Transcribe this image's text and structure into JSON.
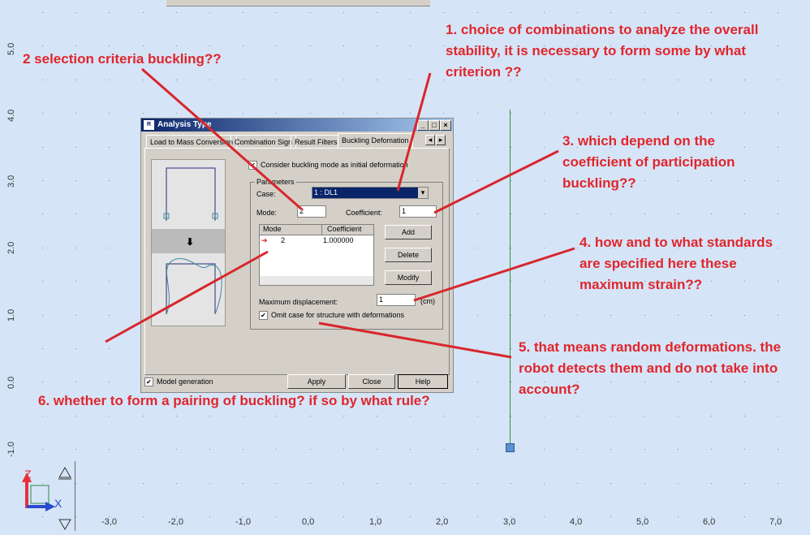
{
  "viewport": {
    "y_ticks": [
      "5.0",
      "4.0",
      "3.0",
      "2.0",
      "1.0",
      "0.0",
      "-1.0"
    ],
    "x_ticks": [
      "-3,0",
      "-2,0",
      "-1,0",
      "0,0",
      "1,0",
      "2,0",
      "3,0",
      "4,0",
      "5,0",
      "6,0",
      "7,0"
    ],
    "axis_z": "Z",
    "axis_x": "X",
    "colors": {
      "background": "#d6e4f7",
      "member": "#2a9a3a",
      "node": "#4a7fc0"
    }
  },
  "dialog": {
    "title": "Analysis Type",
    "tabs": [
      "Load to Mass Conversion",
      "Combination Sign",
      "Result Filters",
      "Buckling Defomation"
    ],
    "consider_label": "Consider buckling mode as initial deformation",
    "parameters_label": "Parameters",
    "case_label": "Case:",
    "case_value": "1 : DL1",
    "mode_label": "Mode:",
    "mode_value": "2",
    "coef_label": "Coefficient:",
    "coef_value": "1",
    "table": {
      "headers": [
        "Mode",
        "Coefficient"
      ],
      "rows": [
        {
          "mode": "2",
          "coefficient": "1.000000"
        }
      ]
    },
    "add": "Add",
    "delete": "Delete",
    "modify": "Modify",
    "maxdisp_label": "Maximum displacement:",
    "maxdisp_value": "1",
    "maxdisp_unit": "(cm)",
    "omit_label": "Omit case for structure with deformations",
    "model_gen_label": "Model generation",
    "apply": "Apply",
    "close": "Close",
    "help": "Help"
  },
  "annotations": [
    "1. choice of combinations to analyze the overall stability, it is necessary to form some by what criterion ??",
    "2 selection criteria buckling??",
    "3. which depend on the coefficient of participation buckling??",
    "4. how and to what standards are specified here these maximum strain??",
    "5. that means random deformations. the robot detects them and do not take into account?",
    "6. whether to form a pairing of buckling? if so by what rule?"
  ]
}
